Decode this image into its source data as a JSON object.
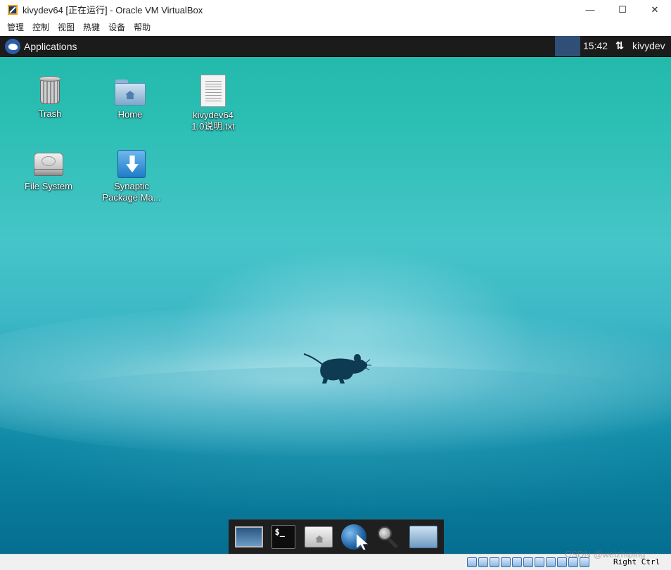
{
  "window": {
    "title": "kivydev64 [正在运行] - Oracle VM VirtualBox",
    "buttons": {
      "minimize": "—",
      "maximize": "☐",
      "close": "✕"
    }
  },
  "menubar": [
    "管理",
    "控制",
    "视图",
    "热键",
    "设备",
    "帮助"
  ],
  "panel": {
    "applications_label": "Applications",
    "clock": "15:42",
    "network_glyph": "⇅",
    "user": "kivydev"
  },
  "desktop": {
    "icons": [
      {
        "name": "trash",
        "label": "Trash",
        "icon": "trash-icon"
      },
      {
        "name": "home",
        "label": "Home",
        "icon": "home-folder-icon"
      },
      {
        "name": "kivydev-readme",
        "label_line1": "kivydev64",
        "label_line2": "1.0说明.txt",
        "icon": "text-document-icon"
      },
      {
        "name": "file-system",
        "label": "File System",
        "icon": "hard-disk-icon"
      },
      {
        "name": "synaptic",
        "label_line1": "Synaptic",
        "label_line2": "Package Ma...",
        "icon": "synaptic-download-icon"
      }
    ]
  },
  "dock": {
    "items": [
      "show-desktop-icon",
      "terminal-icon",
      "home-folder-icon",
      "web-browser-icon",
      "app-finder-icon",
      "file-manager-icon"
    ],
    "terminal_text": "$_"
  },
  "statusbar": {
    "host_key": "Right Ctrl",
    "watermark": "CSDN @weizhiping"
  },
  "colors": {
    "panel": "#1b1b1b",
    "workspace": "#2f4f76",
    "desktop_top": "#1fb8a9",
    "desktop_bottom": "#066e90"
  }
}
